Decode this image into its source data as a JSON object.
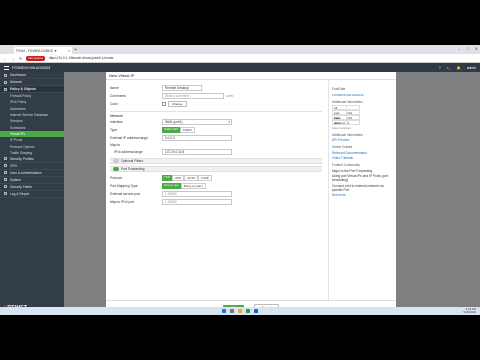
{
  "browser": {
    "tab_title": "FGVirt - FGVMVLOVMUG ▼",
    "address_badge": "Not secure",
    "url": "https://10.0.1.1/firewall-virtual-ip/edit/-1/create"
  },
  "fgtop": {
    "device": "FGVMEVKVWLAG00433",
    "admin": "admin"
  },
  "sidebar": {
    "items": [
      {
        "label": "Dashboard",
        "kind": "item"
      },
      {
        "label": "Network",
        "kind": "item"
      },
      {
        "label": "Policy & Objects",
        "kind": "section"
      },
      {
        "label": "Firewall Policy",
        "kind": "sub"
      },
      {
        "label": "IPv4 Policy",
        "kind": "sub"
      },
      {
        "label": "Addresses",
        "kind": "sub"
      },
      {
        "label": "Internet Service Database",
        "kind": "sub"
      },
      {
        "label": "Services",
        "kind": "sub"
      },
      {
        "label": "Schedules",
        "kind": "sub"
      },
      {
        "label": "Virtual IPs",
        "kind": "sub-active"
      },
      {
        "label": "IP Pools",
        "kind": "sub"
      },
      {
        "label": "Protocol Options",
        "kind": "sub"
      },
      {
        "label": "Traffic Shaping",
        "kind": "sub"
      },
      {
        "label": "Security Profiles",
        "kind": "item"
      },
      {
        "label": "VPN",
        "kind": "item"
      },
      {
        "label": "User & Authentication",
        "kind": "item"
      },
      {
        "label": "System",
        "kind": "item"
      },
      {
        "label": "Security Fabric",
        "kind": "item"
      },
      {
        "label": "Log & Report",
        "kind": "item"
      }
    ],
    "brand_prefix": "F",
    "brand_rest": "RTINET",
    "version": "v7.2.0"
  },
  "dialog": {
    "title": "New Virtual IP",
    "name_label": "Name",
    "name_value": "Remote Desktop",
    "comments_label": "Comments",
    "comments_placeholder": "Write a comment...",
    "comments_counter": "0/255",
    "color_label": "Color",
    "color_button": "Change",
    "network_section": "Network",
    "interface_label": "Interface",
    "interface_value": "WAN (port1)",
    "type_label": "Type",
    "type_on": "Static NAT",
    "type_off": "FQDN",
    "ext_ip_label": "External IP address/range",
    "ext_ip_value": "0.0.0.0",
    "map_to_label": "Map to",
    "ipv4_label": "IPv4 address/range",
    "ipv4_value": "172.20.0.11/4",
    "optional_filters": "Optional Filters",
    "port_forwarding": "Port Forwarding",
    "protocol_label": "Protocol",
    "protocols": [
      "TCP",
      "UDP",
      "SCTP",
      "ICMP"
    ],
    "port_mapping_label": "Port Mapping Type",
    "port_mapping_on": "One to one",
    "port_mapping_off": "Many to many",
    "ext_port_label": "External service port",
    "ext_port_value": "1-65535",
    "map_ports_label": "Map to IPv4 port",
    "map_ports_value": "1-65535",
    "ok": "OK",
    "cancel": "Cancel"
  },
  "right_panel": {
    "fortigate_title": "FortiGate",
    "fortigate_value": "FGVMEVKVWLAG00433",
    "refs_title": "Additional Information",
    "stats": [
      {
        "k": "All",
        "v": ""
      },
      {
        "k": "Last value",
        "v": "N/A"
      },
      {
        "k": "First used",
        "v": "N/A"
      },
      {
        "k": "Hit count",
        "v": "0"
      }
    ],
    "clear_counters": "Clear Counters",
    "info_title": "Additional Information",
    "api_preview": "API Preview",
    "guides_title": "Online Guides",
    "links": [
      "Relevant Documentation",
      "Video Tutorials"
    ],
    "community_title": "Fortinet Community",
    "articles": [
      "Maps to the Port Forwarding",
      "Using port Virtual IPs and IP Pools (port forwarding)",
      "Connect a bit to external network via specific Port",
      "See more"
    ]
  },
  "taskbar": {
    "time": "9:18 AM",
    "date": "5/20/2024"
  }
}
